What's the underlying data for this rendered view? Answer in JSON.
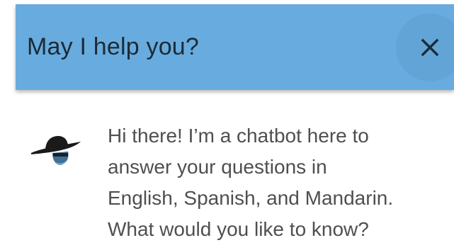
{
  "header": {
    "title": "May I help you?",
    "close_label": "×",
    "background_color": "#68acdf"
  },
  "chat": {
    "avatar_icon": "chatbot-sombrero-avatar",
    "messages": [
      {
        "sender": "bot",
        "lines": [
          "Hi there! I’m a chatbot here to",
          "answer your questions in",
          "English, Spanish, and Mandarin.",
          "What would you like to know?"
        ]
      }
    ]
  }
}
